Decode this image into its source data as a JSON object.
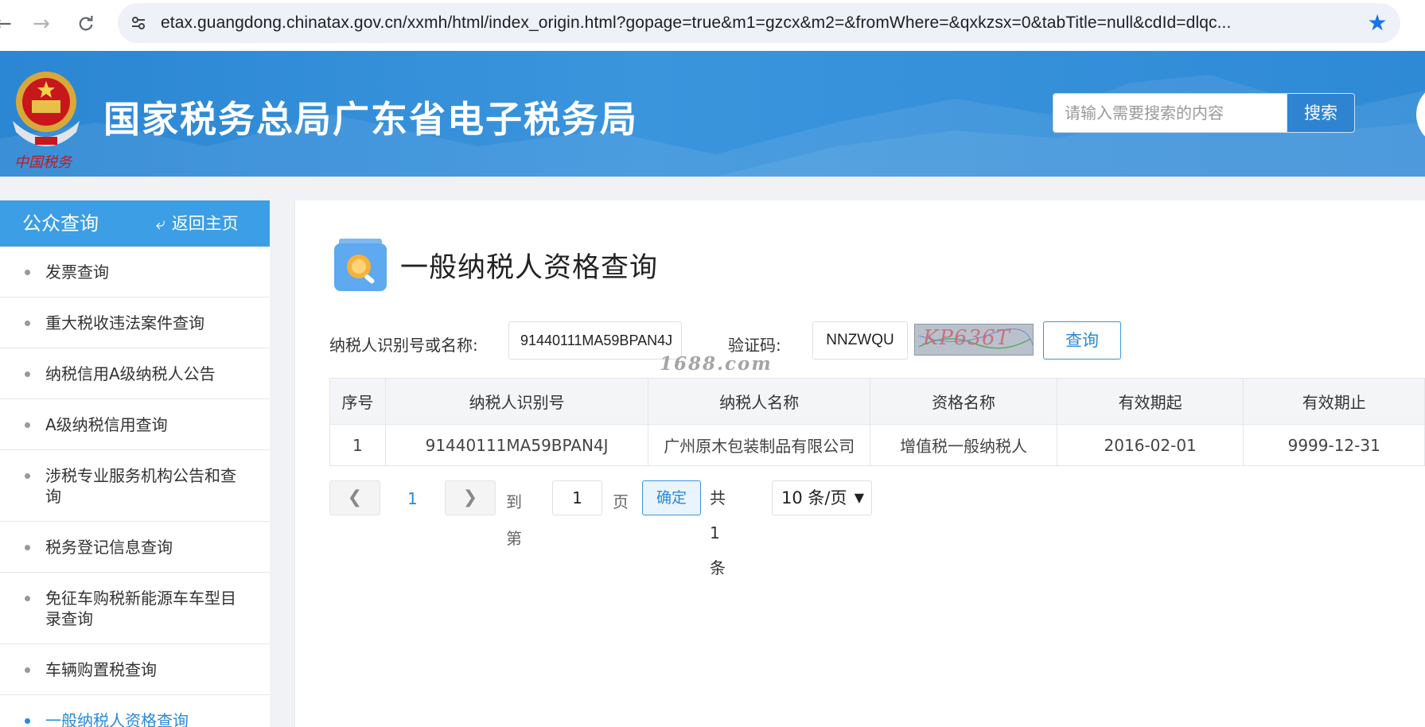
{
  "browser": {
    "back_icon": "arrow-left-icon",
    "forward_icon": "arrow-right-icon",
    "reload_icon": "reload-icon",
    "url": "etax.guangdong.chinatax.gov.cn/xxmh/html/index_origin.html?gopage=true&m1=gzcx&m2=&fromWhere=&qxkzsx=0&tabTitle=null&cdId=dlqc...",
    "bookmark_icon": "star-icon"
  },
  "header": {
    "site_title": "国家税务总局广东省电子税务局",
    "search_placeholder": "请输入需要搜索的内容",
    "search_button": "搜索"
  },
  "sidebar": {
    "title": "公众查询",
    "back_home": "返回主页",
    "items": [
      {
        "label": "发票查询"
      },
      {
        "label": "重大税收违法案件查询"
      },
      {
        "label": "纳税信用A级纳税人公告"
      },
      {
        "label": "A级纳税信用查询"
      },
      {
        "label": "涉税专业服务机构公告和查询"
      },
      {
        "label": "税务登记信息查询"
      },
      {
        "label": "免征车购税新能源车车型目录查询"
      },
      {
        "label": "车辆购置税查询"
      },
      {
        "label": "一般纳税人资格查询"
      }
    ]
  },
  "main": {
    "page_title": "一般纳税人资格查询",
    "form": {
      "taxpayer_label": "纳税人识别号或名称:",
      "taxpayer_value": "91440111MA59BPAN4J",
      "captcha_label": "验证码:",
      "captcha_value": "NNZWQU",
      "captcha_image_text": "KP636T",
      "query_button": "查询"
    },
    "watermark": "1688.com",
    "table": {
      "headers": [
        "序号",
        "纳税人识别号",
        "纳税人名称",
        "资格名称",
        "有效期起",
        "有效期止"
      ],
      "rows": [
        [
          "1",
          "91440111MA59BPAN4J",
          "广州原木包装制品有限公司",
          "增值税一般纳税人",
          "2016-02-01",
          "9999-12-31"
        ]
      ]
    },
    "pagination": {
      "current_page": "1",
      "goto_label": "到第",
      "goto_value": "1",
      "page_unit": "页",
      "confirm": "确定",
      "total": "共 1 条",
      "page_size": "10 条/页"
    }
  },
  "colors": {
    "brand_blue": "#2f84d2",
    "sidebar_head": "#3c9ee4",
    "link_blue": "#2b8ad8"
  }
}
